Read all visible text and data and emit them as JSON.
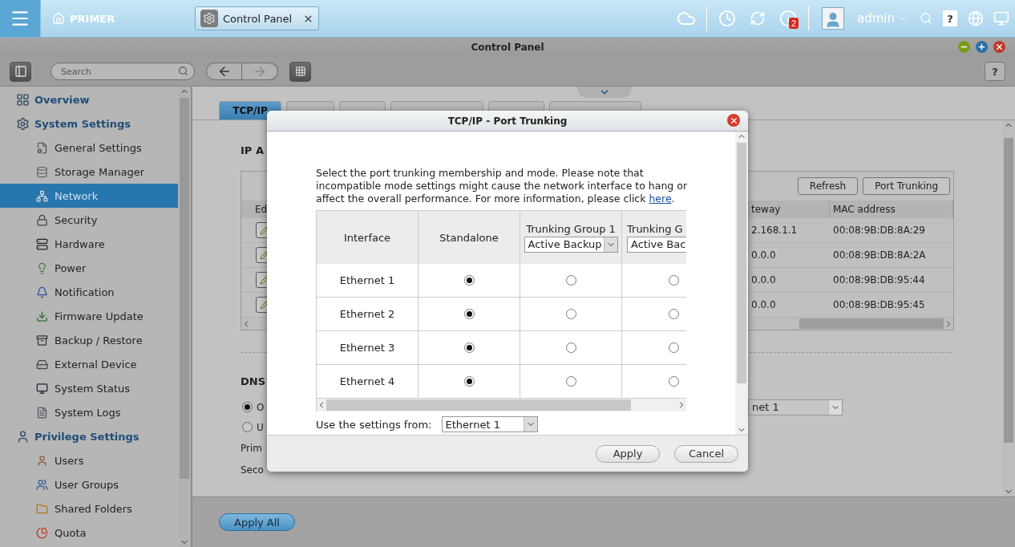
{
  "top_bar": {
    "home_label": "PRIMER",
    "app_tab": "Control Panel",
    "notification_count": "2",
    "user": "admin",
    "help_key": "?"
  },
  "window": {
    "title": "Control Panel",
    "search_placeholder": "Search",
    "help_key": "?"
  },
  "sidebar": {
    "groups": [
      {
        "label": "Overview",
        "selected": false
      },
      {
        "label": "System Settings",
        "selected": false,
        "children": [
          {
            "label": "General Settings",
            "selected": false
          },
          {
            "label": "Storage Manager",
            "selected": false
          },
          {
            "label": "Network",
            "selected": true
          },
          {
            "label": "Security",
            "selected": false
          },
          {
            "label": "Hardware",
            "selected": false
          },
          {
            "label": "Power",
            "selected": false
          },
          {
            "label": "Notification",
            "selected": false
          },
          {
            "label": "Firmware Update",
            "selected": false
          },
          {
            "label": "Backup / Restore",
            "selected": false
          },
          {
            "label": "External Device",
            "selected": false
          },
          {
            "label": "System Status",
            "selected": false
          },
          {
            "label": "System Logs",
            "selected": false
          }
        ]
      },
      {
        "label": "Privilege Settings",
        "selected": false,
        "children": [
          {
            "label": "Users",
            "selected": false
          },
          {
            "label": "User Groups",
            "selected": false
          },
          {
            "label": "Shared Folders",
            "selected": false
          },
          {
            "label": "Quota",
            "selected": false
          }
        ]
      }
    ]
  },
  "tabs": [
    {
      "label": "TCP/IP",
      "selected": true
    },
    {
      "selected": false
    },
    {
      "selected": false
    },
    {
      "selected": false
    },
    {
      "selected": false
    },
    {
      "selected": false
    }
  ],
  "background": {
    "ip_heading": "IP A",
    "buttons": [
      "Refresh",
      "Port Trunking"
    ],
    "columns": [
      "Ed",
      "teway",
      "MAC address"
    ],
    "rows": [
      {
        "gateway": "2.168.1.1",
        "mac": "00:08:9B:DB:8A:29"
      },
      {
        "gateway": "0.0.0",
        "mac": "00:08:9B:DB:8A:2A"
      },
      {
        "gateway": "0.0.0",
        "mac": "00:08:9B:DB:95:44"
      },
      {
        "gateway": "0.0.0",
        "mac": "00:08:9B:DB:95:45"
      }
    ],
    "dns_heading": "DNS",
    "dns_options": [
      {
        "label": "O",
        "selected": true
      },
      {
        "label": "U",
        "selected": false
      }
    ],
    "dns_select": "net 1",
    "fields": [
      "Prim",
      "Seco"
    ]
  },
  "apply_all": "Apply All",
  "dialog": {
    "title": "TCP/IP - Port Trunking",
    "intro": "Select the port trunking membership and mode. Please note that incompatible mode settings might cause the network interface to hang or affect the overall performance. For more information, please click ",
    "link": "here",
    "after_link": ".",
    "columns": [
      {
        "label": "Interface"
      },
      {
        "label": "Standalone"
      },
      {
        "label": "Trunking Group 1",
        "mode": "Active Backup"
      },
      {
        "label": "Trunking G",
        "mode": "Active Bac"
      }
    ],
    "rows": [
      {
        "interface": "Ethernet 1",
        "cells": [
          {
            "selected": true
          },
          {
            "selected": false
          },
          {
            "selected": false
          }
        ]
      },
      {
        "interface": "Ethernet 2",
        "cells": [
          {
            "selected": true
          },
          {
            "selected": false
          },
          {
            "selected": false
          }
        ]
      },
      {
        "interface": "Ethernet 3",
        "cells": [
          {
            "selected": true
          },
          {
            "selected": false
          },
          {
            "selected": false
          }
        ]
      },
      {
        "interface": "Ethernet 4",
        "cells": [
          {
            "selected": true
          },
          {
            "selected": false
          },
          {
            "selected": false
          }
        ]
      }
    ],
    "settings_label": "Use the settings from:",
    "settings_value": "Ethernet 1",
    "buttons": [
      "Apply",
      "Cancel"
    ]
  }
}
